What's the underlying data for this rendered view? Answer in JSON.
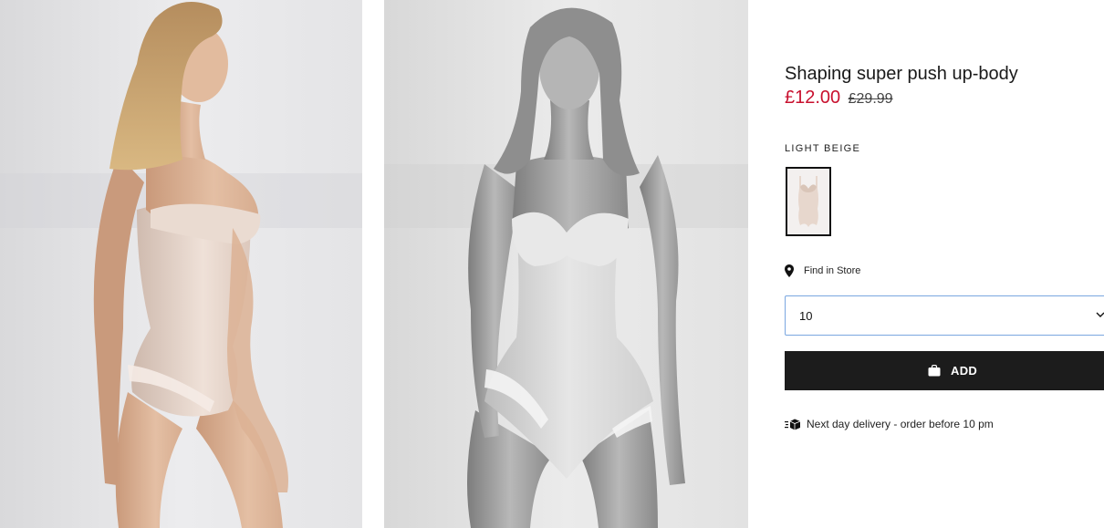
{
  "product": {
    "title": "Shaping super push up-body",
    "price_now": "£12.00",
    "price_was": "£29.99",
    "color_label": "LIGHT BEIGE",
    "find_in_store": "Find in Store",
    "size_selected": "10",
    "add_label": "ADD",
    "delivery_text": "Next day delivery - order before 10 pm"
  },
  "colors": {
    "sale_price": "#c8102e",
    "button_bg": "#1c1c1c",
    "select_border": "#7aa7e0"
  },
  "icons": {
    "find_store": "map-pin-icon",
    "add": "shopping-bag-icon",
    "delivery": "fast-delivery-icon",
    "select": "chevron-down-icon"
  }
}
